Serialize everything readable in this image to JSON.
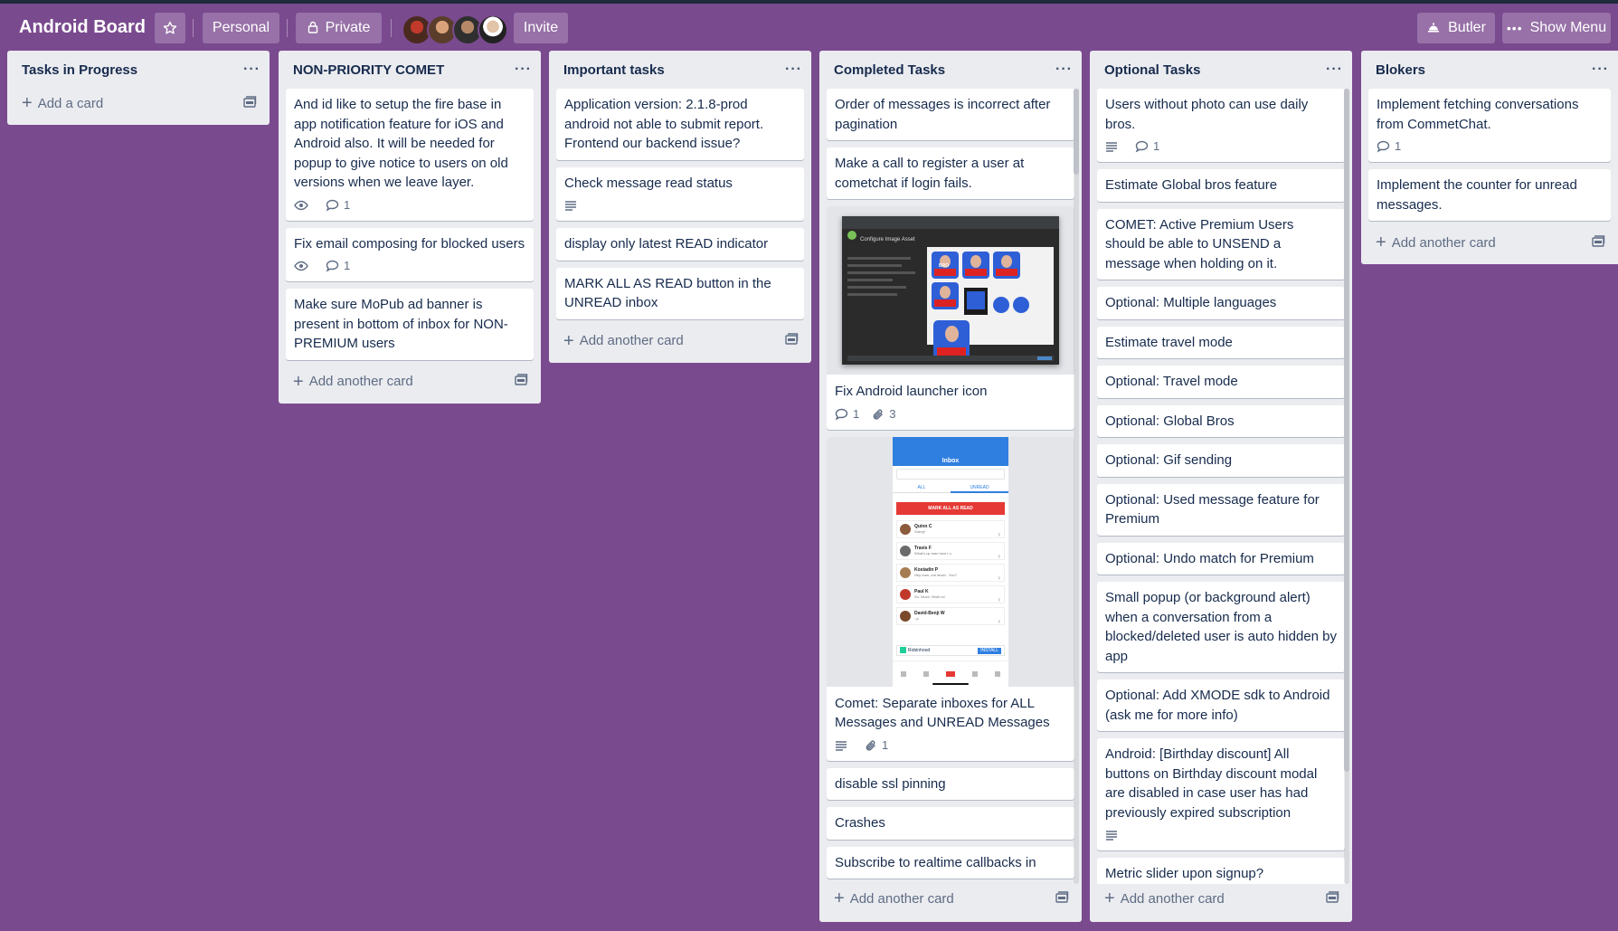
{
  "header": {
    "board_title": "Android Board",
    "personal_label": "Personal",
    "private_label": "Private",
    "invite_label": "Invite",
    "butler_label": "Butler",
    "show_menu_label": "Show Menu"
  },
  "lists": [
    {
      "title": "Tasks in Progress",
      "add_label": "Add a card",
      "cards": []
    },
    {
      "title": "NON-PRIORITY COMET",
      "add_label": "Add another card",
      "cards": [
        {
          "text": "And id like to setup the fire base in app notification feature for iOS and Android also. It will be needed for popup to give notice to users on old versions when we leave layer.",
          "badges": {
            "watch": true,
            "comments": "1"
          }
        },
        {
          "text": "Fix email composing for blocked users",
          "badges": {
            "watch": true,
            "comments": "1"
          }
        },
        {
          "text": "Make sure MoPub ad banner is present in bottom of inbox for NON-PREMIUM users"
        }
      ]
    },
    {
      "title": "Important tasks",
      "add_label": "Add another card",
      "cards": [
        {
          "text": "Application version: 2.1.8-prod android not able to submit report. Frontend our backend issue?"
        },
        {
          "text": "Check message read status",
          "badges": {
            "description": true
          }
        },
        {
          "text": "display only latest READ indicator"
        },
        {
          "text": "MARK ALL AS READ button in the UNREAD inbox"
        }
      ]
    },
    {
      "title": "Completed Tasks",
      "add_label": "Add another card",
      "cards": [
        {
          "text": "Order of messages is incorrect after pagination"
        },
        {
          "text": "Make a call to register a user at cometchat if login fails."
        },
        {
          "text": "Fix Android launcher icon",
          "badges": {
            "comments": "1",
            "attachments": "3"
          }
        },
        {
          "text": "Comet: Separate inboxes for ALL Messages and UNREAD Messages",
          "badges": {
            "description": true,
            "attachments": "1"
          }
        },
        {
          "text": "disable ssl pinning"
        },
        {
          "text": "Crashes"
        },
        {
          "text": "Subscribe to realtime callbacks in"
        }
      ],
      "cover1": {
        "title": "Configure Image Asset",
        "badge": "BRO"
      },
      "cover2": {
        "title": "Inbox",
        "tab_all": "ALL",
        "tab_unread": "UNREAD",
        "mark_all": "MARK ALL AS READ",
        "rows": [
          {
            "name": "Quinn C",
            "msg": "Going*"
          },
          {
            "name": "Travis F",
            "msg": "What's up man how r u"
          },
          {
            "name": "Kostadin P",
            "msg": "Hey man, not much . You?"
          },
          {
            "name": "Paul K",
            "msg": "So. Much. Work lol"
          },
          {
            "name": "David-Benji W",
            "msg": ":-p"
          }
        ],
        "ad_name": "Robinhood",
        "ad_install": "INSTALL"
      }
    },
    {
      "title": "Optional Tasks",
      "add_label": "Add another card",
      "cards": [
        {
          "text": "Users without photo can use daily bros.",
          "badges": {
            "description": true,
            "comments": "1"
          }
        },
        {
          "text": "Estimate Global bros feature"
        },
        {
          "text": "COMET: Active Premium Users should be able to UNSEND a message when holding on it."
        },
        {
          "text": "Optional: Multiple languages"
        },
        {
          "text": "Estimate travel mode"
        },
        {
          "text": "Optional: Travel mode"
        },
        {
          "text": "Optional: Global Bros"
        },
        {
          "text": "Optional: Gif sending"
        },
        {
          "text": "Optional: Used message feature for Premium"
        },
        {
          "text": "Optional: Undo match for Premium"
        },
        {
          "text": "Small popup (or background alert) when a conversation from a blocked/deleted user is auto hidden by app"
        },
        {
          "text": "Optional: Add XMODE sdk to Android (ask me for more info)"
        },
        {
          "text": "Android: [Birthday discount] All buttons on Birthday discount modal are disabled in case user has had previously expired subscription",
          "badges": {
            "description": true
          }
        },
        {
          "text": "Metric slider upon signup?"
        }
      ]
    },
    {
      "title": "Blokers",
      "add_label": "Add another card",
      "cards": [
        {
          "text": "Implement fetching conversations from CommetChat.",
          "badges": {
            "comments": "1"
          }
        },
        {
          "text": "Implement the counter for unread messages."
        }
      ]
    }
  ],
  "colors": {
    "board_bg": "#7a4a8f",
    "list_bg": "#ebecf0",
    "card_bg": "#ffffff",
    "text": "#172b4d",
    "muted": "#5e6c84"
  }
}
